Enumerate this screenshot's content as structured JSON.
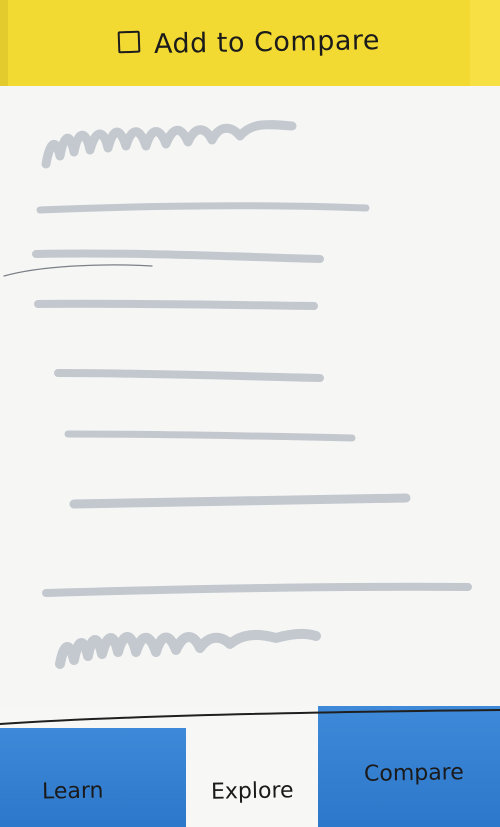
{
  "header": {
    "compare_checked": false,
    "compare_label": "Add to Compare",
    "accent_color": "#f3da32"
  },
  "content": {
    "placeholder_color": "#c3c8ce",
    "items": [
      {
        "kind": "squiggle"
      },
      {
        "kind": "line"
      },
      {
        "kind": "line"
      },
      {
        "kind": "line"
      },
      {
        "kind": "line"
      },
      {
        "kind": "line"
      },
      {
        "kind": "line"
      },
      {
        "kind": "line"
      },
      {
        "kind": "squiggle"
      }
    ]
  },
  "bottom_nav": {
    "tabs": [
      {
        "label": "Learn",
        "color": "#2f7fd6"
      },
      {
        "label": "Explore",
        "selected": true
      },
      {
        "label": "Compare",
        "color": "#2f7fd6"
      }
    ]
  }
}
